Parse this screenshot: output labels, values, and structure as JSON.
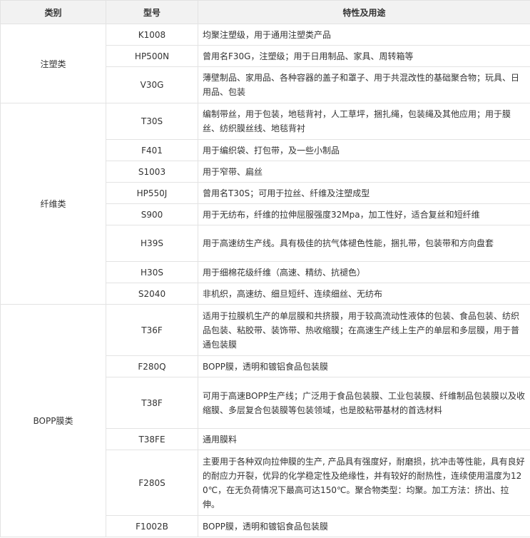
{
  "table": {
    "headers": [
      "类别",
      "型号",
      "特性及用途"
    ],
    "groups": [
      {
        "category": "注塑类",
        "rows": [
          {
            "model": "K1008",
            "use": "均聚注塑级，用于通用注塑类产品"
          },
          {
            "model": "HP500N",
            "use": "曾用名F30G，注塑级；用于日用制品、家具、周转箱等"
          },
          {
            "model": "V30G",
            "use": "薄壁制品、家用品、各种容器的盖子和罩子、用于共混改性的基础聚合物；玩具、日用品、包装"
          }
        ]
      },
      {
        "category": "纤维类",
        "rows": [
          {
            "model": "T30S",
            "use": "编制带丝，用于包装，地毯背衬，人工草坪，捆扎绳，包装绳及其他应用；用于膜丝、纺织膜丝线、地毯背衬"
          },
          {
            "model": "F401",
            "use": "用于编织袋、打包带，及一些小制品"
          },
          {
            "model": "S1003",
            "use": "用于窄带、扁丝"
          },
          {
            "model": "HP550J",
            "use": "曾用名T30S；可用于拉丝、纤维及注塑成型"
          },
          {
            "model": "S900",
            "use": "用于无纺布，纤维的拉伸屈服强度32Mpa，加工性好，适合复丝和短纤维"
          },
          {
            "model": "H39S",
            "use": "用于高速纺生产线。具有极佳的抗气体褪色性能，捆扎带，包装带和方向盘套"
          },
          {
            "model": "H30S",
            "use": "用于细棉花级纤维（高速、精纺、抗褪色）"
          },
          {
            "model": "S2040",
            "use": "非机织，高速纺、细旦短纤、连续细丝、无纺布"
          }
        ]
      },
      {
        "category": "BOPP膜类",
        "rows": [
          {
            "model": "T36F",
            "use": "适用于拉膜机生产的单层膜和共挤膜，用于较高流动性液体的包装、食品包装、纺织品包装、粘胶带、装饰带、热收缩膜；在高速生产线上生产的单层和多层膜，用于普通包装膜"
          },
          {
            "model": "F280Q",
            "use": "BOPP膜，透明和镀铝食品包装膜"
          },
          {
            "model": "T38F",
            "use": "可用于高速BOPP生产线；广泛用于食品包装膜、工业包装膜、纤维制品包装膜以及收缩膜、多层复合包装膜等包装领域，也是胶粘带基材的首选材料"
          },
          {
            "model": "T38FE",
            "use": "通用膜料"
          },
          {
            "model": "F280S",
            "use": "主要用于各种双向拉伸膜的生产, 产品具有强度好，耐磨损，抗冲击等性能，具有良好的耐应力开裂，优异的化学稳定性及绝缘性，并有较好的耐热性，连续使用温度为120℃，在无负荷情况下最高可达150℃。聚合物类型：均聚。加工方法：挤出、拉伸。"
          },
          {
            "model": "F1002B",
            "use": "BOPP膜，透明和镀铝食品包装膜"
          }
        ]
      }
    ]
  }
}
